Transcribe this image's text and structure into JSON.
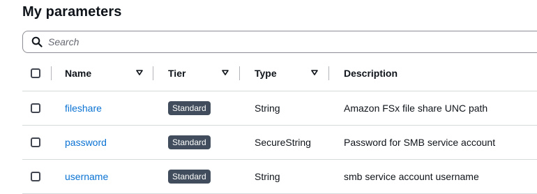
{
  "page": {
    "title": "My parameters"
  },
  "search": {
    "placeholder": "Search",
    "value": ""
  },
  "table": {
    "columns": {
      "name": "Name",
      "tier": "Tier",
      "type": "Type",
      "description": "Description"
    },
    "rows": [
      {
        "name": "fileshare",
        "tier": "Standard",
        "type": "String",
        "description": "Amazon FSx file share UNC path"
      },
      {
        "name": "password",
        "tier": "Standard",
        "type": "SecureString",
        "description": "Password for SMB service account"
      },
      {
        "name": "username",
        "tier": "Standard",
        "type": "String",
        "description": "smb service account username"
      }
    ]
  },
  "colors": {
    "link": "#0972d3",
    "badge": "#414d5c",
    "divider": "#d5dbdb"
  },
  "icons": {
    "search": "search-icon",
    "sort": "sort-down-icon"
  }
}
